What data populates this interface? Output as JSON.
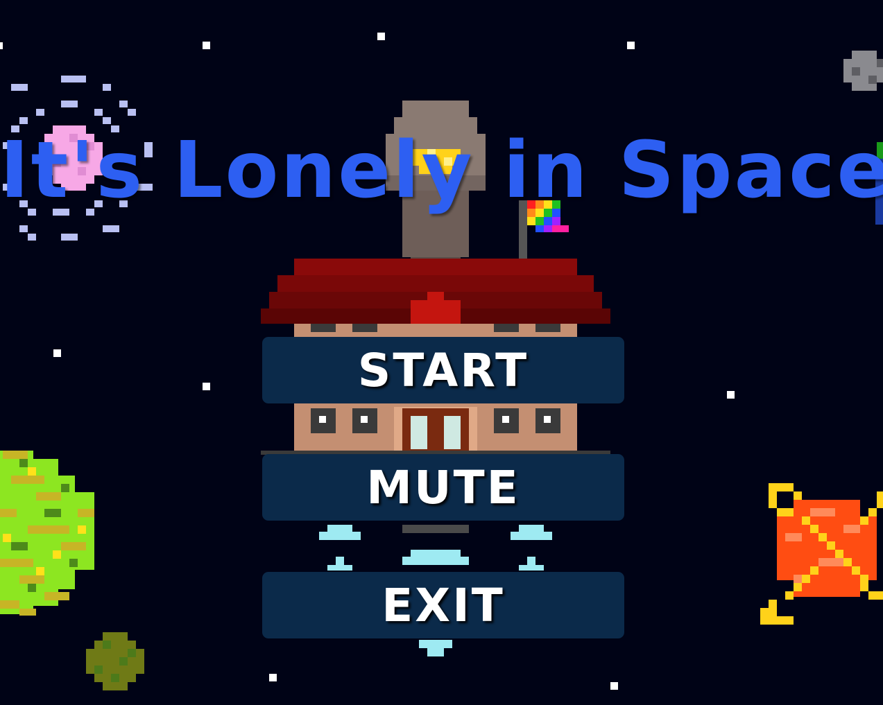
{
  "title": "It's Lonely in Space",
  "menu": {
    "start_label": "START",
    "mute_label": "MUTE",
    "exit_label": "EXIT"
  },
  "colors": {
    "background": "#000316",
    "title": "#2d5ff2",
    "button_bg": "#0b2a4a",
    "button_text": "#ffffff"
  },
  "sprites": [
    "rocket-ship-sprite",
    "rainbow-flag-sprite",
    "pink-planet-sprite",
    "green-planet-sprite",
    "small-green-planet-sprite",
    "orange-ringed-planet-sprite",
    "gray-asteroid-sprite",
    "star-sprite"
  ]
}
